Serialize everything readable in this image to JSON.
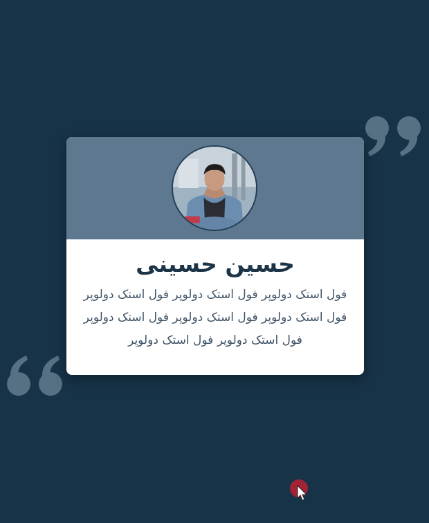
{
  "profile": {
    "name": "حسین حسینی",
    "bio": "فول استک دولوپر فول استک دولوپر فول استک دولوپر فول استک دولوپر فول استک دولوپر فول استک دولوپر فول استک دولوپر فول استک دولوپر",
    "avatar": "profile-photo"
  },
  "decor": {
    "open_quote_icon": "open-quote-icon",
    "close_quote_icon": "close-quote-icon"
  },
  "colors": {
    "background": "#173348",
    "card_header": "#5e7890",
    "card_body": "#ffffff",
    "quote": "#5a7488",
    "name_text": "#1c3448",
    "bio_text": "#3f5366"
  }
}
